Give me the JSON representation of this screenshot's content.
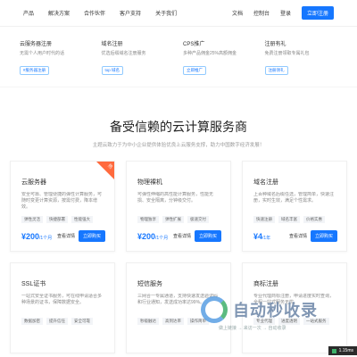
{
  "header": {
    "nav": [
      "产品",
      "解决方案",
      "合作伙伴",
      "客户支持",
      "关于我们"
    ],
    "docs": "文档",
    "console": "控制台",
    "login": "登录",
    "register": "立即注册"
  },
  "features": [
    {
      "title": "云服务器注册",
      "desc": "无需个人用户时代的话",
      "btn": "#服务器注册"
    },
    {
      "title": "域名注册",
      "desc": "优选后缀域名注册服务",
      "btn": "top 域名"
    },
    {
      "title": "CPS推广",
      "desc": "多种产品佣金25%高额佣金",
      "btn": "立即推广"
    },
    {
      "title": "注册有礼",
      "desc": "免费注册领取专属礼包",
      "btn": "注册领礼"
    }
  ],
  "hero": {
    "title": "备受信赖的云计算服务商",
    "subtitle": "主题云致力于为中小企业提供体验优良上云服务支撑，助力中国数字经济发展！"
  },
  "products": [
    {
      "title": "云服务器",
      "desc": "安全可靠、管理便捷的弹性计算服务，可随时变更计算资源，按需付费，降本增效。",
      "tags": [
        "弹性灵活",
        "快捷部署",
        "性能强大"
      ],
      "price": "¥200",
      "unit": "/1个月",
      "detail": "查看详情",
      "buy": "立即购买",
      "ribbon": "热"
    },
    {
      "title": "物理裸机",
      "desc": "可弹性伸缩的高性能计算服务，性能无损、安全隔离，分钟级交付。",
      "tags": [
        "物理独享",
        "弹性扩展",
        "极速交付"
      ],
      "price": "¥200",
      "unit": "/1个月",
      "detail": "查看详情",
      "buy": "立即购买"
    },
    {
      "title": "域名注册",
      "desc": "上百种域名后缀任选，管理简单，快速注册，实时生效，满足个性需求。",
      "tags": [
        "快速注册",
        "域名丰富",
        "价格实惠"
      ],
      "price": "¥4",
      "unit": "/1年",
      "detail": "查看详情",
      "buy": "立即购买"
    },
    {
      "title": "SSL证书",
      "desc": "一站式安全证书服务，可在线申请适合多种场景的证书，保障数据安全。",
      "tags": [
        "数据加密",
        "提升信任",
        "安全可靠"
      ]
    },
    {
      "title": "短信服务",
      "desc": "三网合一专属通道，支持快速发送验证码和行业通知，发送成功率达99%。",
      "tags": [
        "秒级触达",
        "高到达率",
        "操作简单"
      ]
    },
    {
      "title": "商标注册",
      "desc": "专业代理商标注册，申请进度实时查询，全程一站式服务无忧。",
      "tags": [
        "专业代理",
        "进度透明",
        "一站式服务"
      ]
    }
  ],
  "watermark": {
    "text": "自动秒收录",
    "sub": "做上链接 → 来访一次 → 自动收录"
  },
  "speed": {
    "text": "1.15ms"
  }
}
